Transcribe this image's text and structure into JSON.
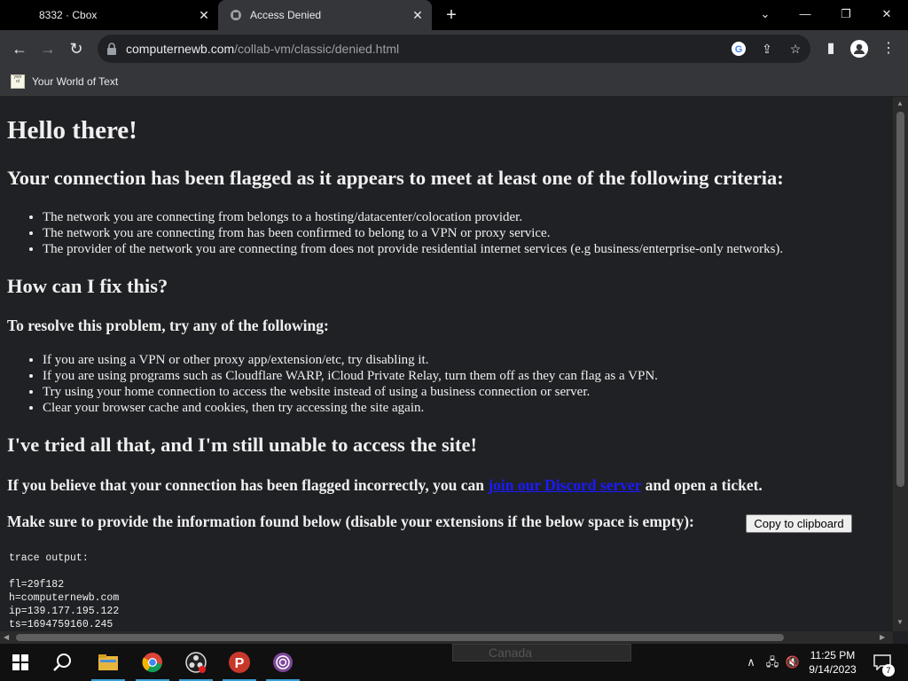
{
  "tabs": [
    {
      "title": "8332 · Cbox",
      "active": false
    },
    {
      "title": "Access Denied",
      "active": true
    }
  ],
  "address_bar": {
    "host": "computernewb.com",
    "path": "/collab-vm/classic/denied.html"
  },
  "bookmarks": [
    {
      "label": "Your World of Text"
    }
  ],
  "page": {
    "title": "Hello there!",
    "flag_heading": "Your connection has been flagged as it appears to meet at least one of the following criteria:",
    "criteria": [
      "The network you are connecting from belongs to a hosting/datacenter/colocation provider.",
      "The network you are connecting from has been confirmed to belong to a VPN or proxy service.",
      "The provider of the network you are connecting from does not provide residential internet services (e.g business/enterprise-only networks)."
    ],
    "fix_heading": "How can I fix this?",
    "resolve_heading": "To resolve this problem, try any of the following:",
    "fixes": [
      "If you are using a VPN or other proxy app/extension/etc, try disabling it.",
      "If you are using programs such as Cloudflare WARP, iCloud Private Relay, turn them off as they can flag as a VPN.",
      "Try using your home connection to access the website instead of using a business connection or server.",
      "Clear your browser cache and cookies, then try accessing the site again."
    ],
    "tried_heading": "I've tried all that, and I'm still unable to access the site!",
    "incorrect_prefix": "If you believe that your connection has been flagged incorrectly, you can",
    "discord_link": "join our Discord server",
    "incorrect_suffix": "and open a ticket.",
    "provide_info": "Make sure to provide the information found below (disable your extensions if the below space is empty):",
    "copy_button": "Copy to clipboard",
    "trace_output": "trace output:\n\nfl=29f182\nh=computernewb.com\nip=139.177.195.122\nts=1694759160.245"
  },
  "taskbar": {
    "ghost_text": "Canada",
    "time": "11:25 PM",
    "date": "9/14/2023",
    "notification_count": "7"
  },
  "colors": {
    "page_background": "#202124",
    "link": "#1a1aff",
    "browser_chrome": "#35363a"
  }
}
